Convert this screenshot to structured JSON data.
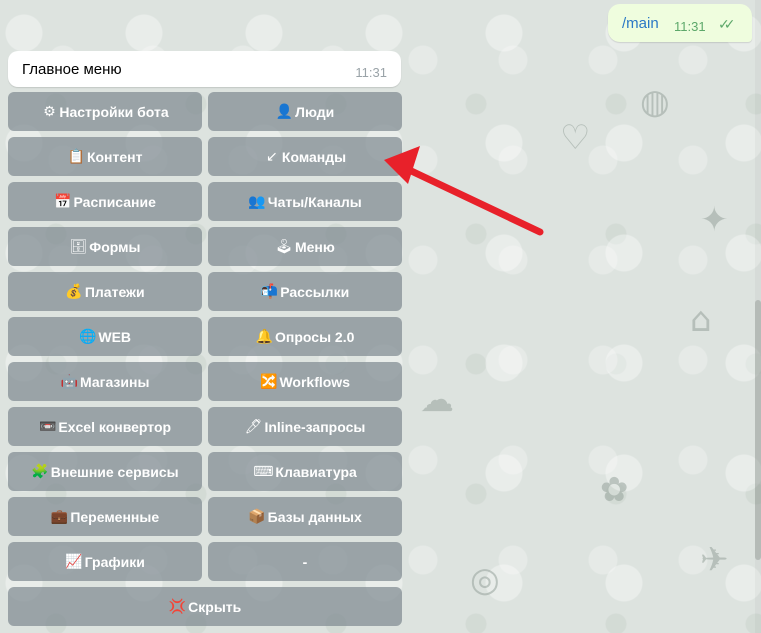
{
  "outgoing_message": {
    "text": "/main",
    "time": "11:31",
    "status_icon": "double-check-icon"
  },
  "incoming_message": {
    "text": "Главное меню",
    "time": "11:31"
  },
  "keyboard": {
    "rows": [
      [
        {
          "icon": "⚙",
          "icon_name": "gear-icon",
          "label": "Настройки бота"
        },
        {
          "icon": "👤",
          "icon_name": "person-icon",
          "label": "Люди"
        }
      ],
      [
        {
          "icon": "📋",
          "icon_name": "clipboard-icon",
          "label": "Контент"
        },
        {
          "icon": "↙",
          "icon_name": "arrow-down-left-icon",
          "label": "Команды"
        }
      ],
      [
        {
          "icon": "📅",
          "icon_name": "calendar-icon",
          "label": "Расписание"
        },
        {
          "icon": "👥",
          "icon_name": "people-icon",
          "label": "Чаты/Каналы"
        }
      ],
      [
        {
          "icon": "🗄",
          "icon_name": "file-cabinet-icon",
          "label": "Формы"
        },
        {
          "icon": "🕹",
          "icon_name": "joystick-icon",
          "label": "Меню"
        }
      ],
      [
        {
          "icon": "💰",
          "icon_name": "money-bag-icon",
          "label": "Платежи"
        },
        {
          "icon": "📬",
          "icon_name": "mailbox-icon",
          "label": "Рассылки"
        }
      ],
      [
        {
          "icon": "🌐",
          "icon_name": "globe-icon",
          "label": "WEB"
        },
        {
          "icon": "🔔",
          "icon_name": "bell-icon",
          "label": "Опросы 2.0"
        }
      ],
      [
        {
          "icon": "🤖",
          "icon_name": "robot-icon",
          "label": "Магазины"
        },
        {
          "icon": "🔀",
          "icon_name": "shuffle-icon",
          "label": "Workflows"
        }
      ],
      [
        {
          "icon": "📼",
          "icon_name": "cassette-icon",
          "label": "Excel конвертор"
        },
        {
          "icon": "🖊",
          "icon_name": "pen-icon",
          "label": "Inline-запросы"
        }
      ],
      [
        {
          "icon": "🧩",
          "icon_name": "puzzle-icon",
          "label": "Внешние сервисы"
        },
        {
          "icon": "⌨",
          "icon_name": "keyboard-icon",
          "label": "Клавиатура"
        }
      ],
      [
        {
          "icon": "💼",
          "icon_name": "briefcase-icon",
          "label": "Переменные"
        },
        {
          "icon": "📦",
          "icon_name": "package-icon",
          "label": "Базы данных"
        }
      ],
      [
        {
          "icon": "📈",
          "icon_name": "chart-icon",
          "label": "Графики"
        },
        {
          "icon": "",
          "icon_name": "",
          "label": "-"
        }
      ],
      [
        {
          "icon": "💢",
          "icon_name": "anger-icon",
          "label": "Скрыть"
        }
      ]
    ]
  },
  "annotation": {
    "color": "#e8212a",
    "target": "Команды"
  }
}
